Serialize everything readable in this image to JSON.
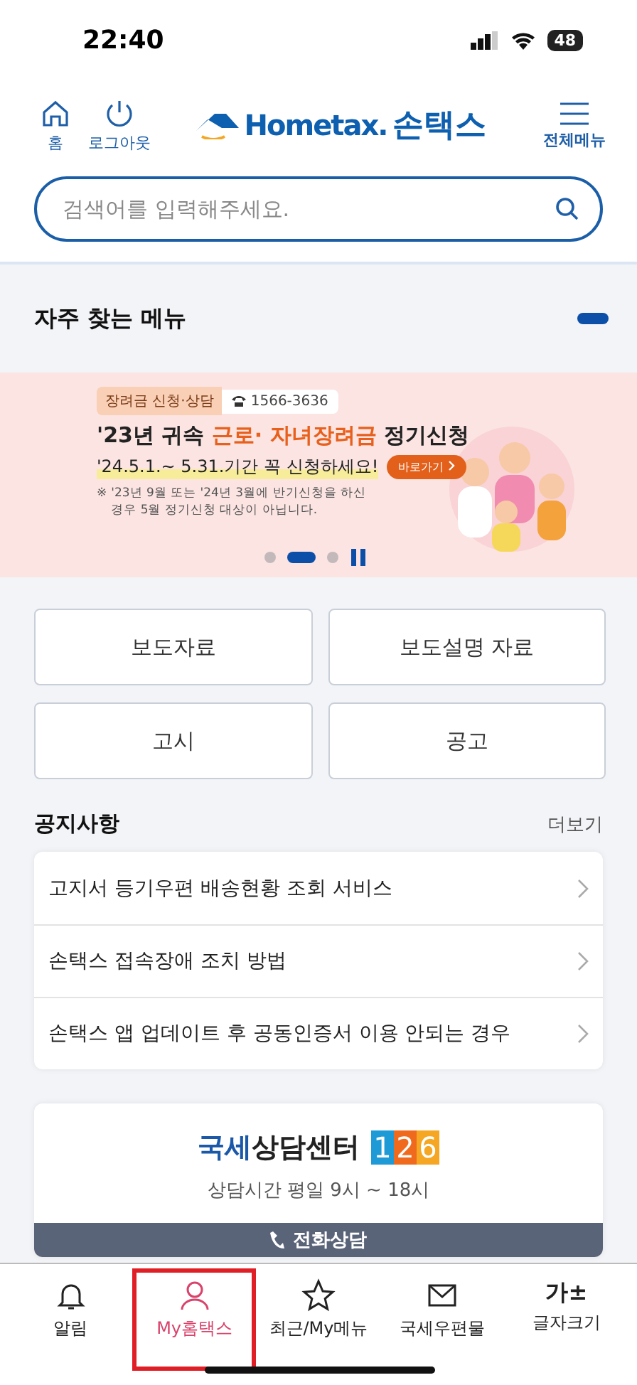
{
  "status_bar": {
    "time": "22:40",
    "battery": "48"
  },
  "header": {
    "left_buttons": [
      {
        "kind": "home",
        "label": "홈"
      },
      {
        "kind": "power",
        "label": "로그아웃"
      }
    ],
    "logo": {
      "brand": "Hometax.",
      "name": "손택스"
    },
    "menu_label": "전체메뉴"
  },
  "search": {
    "placeholder": "검색어를 입력해주세요."
  },
  "favorites": {
    "title": "자주 찾는 메뉴",
    "expanded": false
  },
  "banner": {
    "tag": "장려금 신청·상담",
    "phone": "1566-3636",
    "title_before": "'23년 귀속 ",
    "title_highlight": "근로· 자녀장려금",
    "title_after": " 정기신청",
    "period": "'24.5.1.~ 5.31.기간 꼭 신청하세요!",
    "go_button": "바로가기",
    "note_mark": "※",
    "note": "'23년 9월 또는 '24년 3월에 반기신청을 하신 경우 5월 정기신청 대상이 아닙니다.",
    "dots": [
      {
        "selected": false
      },
      {
        "selected": true
      },
      {
        "selected": false
      }
    ]
  },
  "quick_buttons": [
    "보도자료",
    "보도설명 자료",
    "고시",
    "공고"
  ],
  "notices": {
    "title": "공지사항",
    "more": "더보기",
    "items": [
      "고지서 등기우편 배송현황 조회 서비스",
      "손택스 접속장애 조치 방법",
      "손택스 앱 업데이트 후 공동인증서 이용 안되는 경우"
    ]
  },
  "consult": {
    "title_blue": "국세",
    "title_rest": "상담센터",
    "number_digits": [
      {
        "digit": "1",
        "color": "#1e9ad6"
      },
      {
        "digit": "2",
        "color": "#f06a1e"
      },
      {
        "digit": "6",
        "color": "#f5a623"
      }
    ],
    "hours": "상담시간 평일 9시 ~ 18시",
    "call_button": "전화상담"
  },
  "bottom_nav": [
    {
      "kind": "bell",
      "label": "알림",
      "selected": false,
      "highlighted": false
    },
    {
      "kind": "person",
      "label": "My홈택스",
      "selected": true,
      "highlighted": true
    },
    {
      "kind": "star",
      "label": "최근/My메뉴",
      "selected": false,
      "highlighted": false
    },
    {
      "kind": "mail",
      "label": "국세우편물",
      "selected": false,
      "highlighted": false
    },
    {
      "kind": "font",
      "glyph": "가±",
      "label": "글자크기",
      "selected": false,
      "highlighted": false
    }
  ]
}
